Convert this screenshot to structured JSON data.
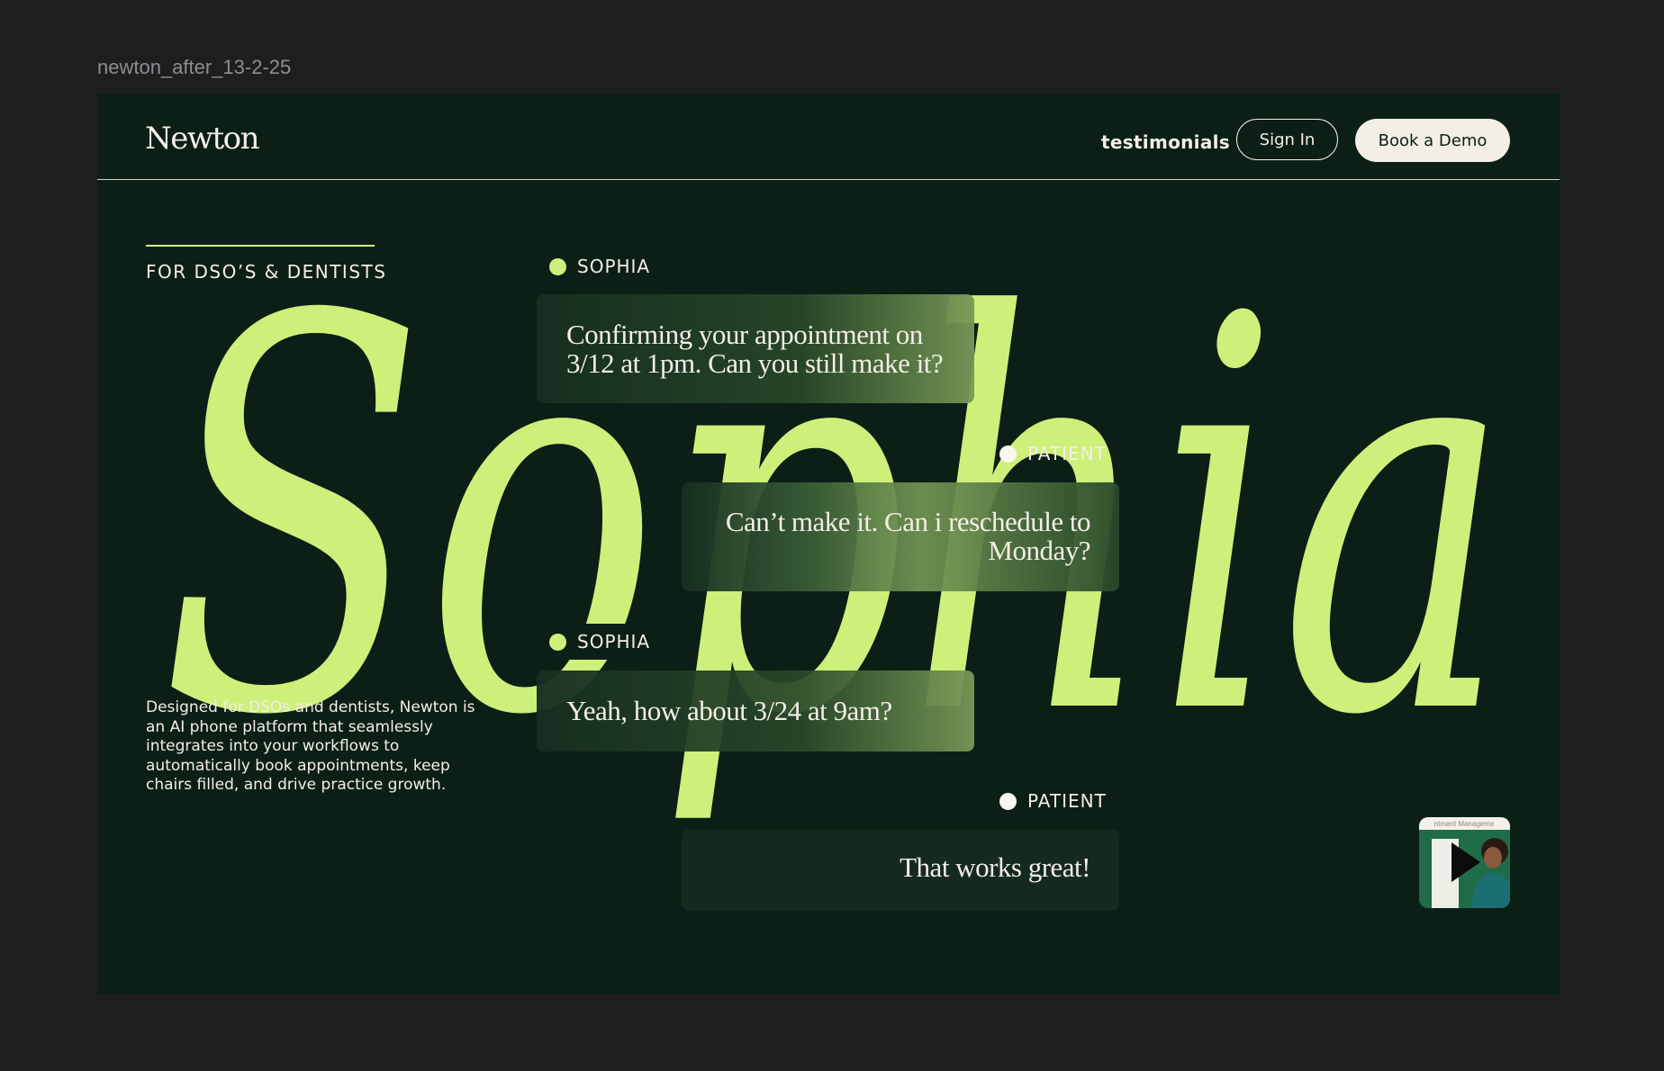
{
  "frame": {
    "label": "newton_after_13-2-25"
  },
  "header": {
    "logo": "Newton",
    "nav_link": "testimonials",
    "sign_in": "Sign In",
    "book_demo": "Book a Demo"
  },
  "hero": {
    "eyebrow": "FOR DSO’S & DENTISTS",
    "big_word": "Sophia",
    "description": "Designed for DSOs and dentists,  Newton is an AI phone platform that seamlessly integrates into your workflows to automatically book appointments, keep chairs filled, and drive practice growth."
  },
  "conversation": [
    {
      "speaker": "SOPHIA",
      "lines": [
        "Confirming your appointment on",
        "3/12 at 1pm. Can you still make it?"
      ]
    },
    {
      "speaker": "PATIENT",
      "lines": [
        "Can’t make it. Can i reschedule to",
        "Monday?"
      ]
    },
    {
      "speaker": "SOPHIA",
      "lines": [
        "Yeah, how about 3/24 at 9am?"
      ]
    },
    {
      "speaker": "PATIENT",
      "lines": [
        "That works great!"
      ]
    }
  ],
  "video": {
    "caption": "ntment Manageme",
    "icon": "play-icon"
  },
  "colors": {
    "page_bg": "#1e1e20",
    "canvas_bg": "#0b1f17",
    "accent_lime": "#cdf07a",
    "cream": "#f3efe6"
  }
}
